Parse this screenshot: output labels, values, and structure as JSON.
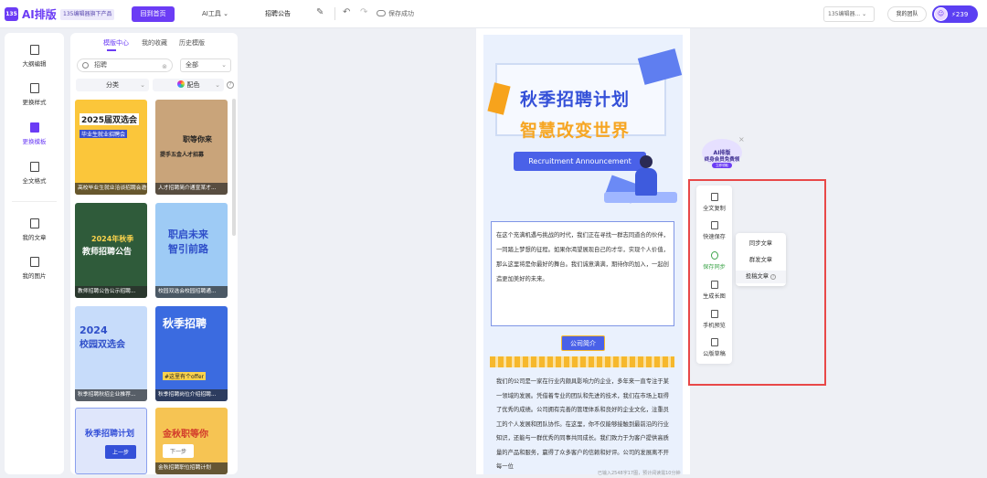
{
  "app": {
    "name": "AI排版",
    "logo_text": "135",
    "editor_chip": "135编辑器旗下产品"
  },
  "toolbar": {
    "back_label": "回到首页",
    "ai_tools_label": "AI工具",
    "doc_title": "招聘公告",
    "save_status": "保存成功",
    "editor_select": "135编辑器...",
    "team_label": "我的团队",
    "points": "239",
    "colors": {
      "accent": "#6b3cf5"
    }
  },
  "leftnav": {
    "items": [
      {
        "label": "大纲编辑",
        "icon": "pen-icon"
      },
      {
        "label": "更换样式",
        "icon": "style-icon"
      },
      {
        "label": "更换模板",
        "icon": "template-icon"
      },
      {
        "label": "全文格式",
        "icon": "format-icon"
      },
      {
        "label": "我的文章",
        "icon": "article-icon"
      },
      {
        "label": "我的图片",
        "icon": "image-icon"
      }
    ],
    "active_index": 2
  },
  "templates": {
    "tabs": [
      "模版中心",
      "我的收藏",
      "历史模版"
    ],
    "active_tab": 0,
    "search_value": "招聘",
    "filter_all": "全部",
    "filter_category": "分类",
    "filter_color": "配色",
    "items": [
      {
        "title": "2025届双选会",
        "subtitle": "毕业生就业招聘会",
        "caption": "高校毕业生就业洽谈招聘会邀请..."
      },
      {
        "title": "职等你来",
        "subtitle": "提手五金人才招募",
        "caption": "人才招聘简介通宣某才..."
      },
      {
        "title": "2024年秋季",
        "subtitle": "教师招聘公告",
        "caption": "教师招聘公告公示招聘..."
      },
      {
        "title": "职启未来",
        "subtitle": "智引前路",
        "caption": "校园双选会校园招聘通..."
      },
      {
        "title": "2024",
        "subtitle": "校园双选会",
        "caption": "秋季招聘秋招企业推荐..."
      },
      {
        "title": "秋季招聘",
        "subtitle": "#这里有个offer",
        "caption": "秋季招聘岗位介绍招聘..."
      },
      {
        "title": "秋季招聘计划",
        "subtitle": "上一步",
        "caption": ""
      },
      {
        "title": "金秋职等你",
        "subtitle": "下一步",
        "caption": "金秋招聘职位招聘计划"
      }
    ]
  },
  "poster": {
    "title1": "秋季招聘计划",
    "title2": "智慧改变世界",
    "badge": "Recruitment Announcement",
    "intro": "在这个充满机遇与挑战的时代，我们正在寻找一群志同道合的伙伴，一同踏上梦想的征程。如果你渴望展现自己的才华，实现个人价值，那么这里将是你最好的舞台。我们诚意满满，期待你的加入，一起创造更加美好的未来。",
    "section_title": "公司简介",
    "body": "我们的公司是一家在行业内颇具影响力的企业，多年来一直专注于某一领域的发展。凭借着专业的团队和先进的技术，我们在市场上取得了优秀的成绩。公司拥有完善的管理体系和良好的企业文化，注重员工的个人发展和团队协作。在这里，你不仅能够接触到最前沿的行业知识，还能与一群优秀的同事共同成长。我们致力于为客户提供高质量的产品和服务，赢得了众多客户的信赖和好评。公司的发展离不开每一位",
    "footer": "已输入2548字17图，预计阅读需10分钟"
  },
  "package_badge": {
    "line1": "AI排版",
    "line2": "终身会员免费领",
    "line3": "立即领取"
  },
  "actions": [
    {
      "label": "全文复制",
      "icon": "copy-icon"
    },
    {
      "label": "快速保存",
      "icon": "save-icon"
    },
    {
      "label": "保存同步",
      "icon": "sync-icon"
    },
    {
      "label": "生成长图",
      "icon": "long-image-icon"
    },
    {
      "label": "手机预览",
      "icon": "phone-icon"
    },
    {
      "label": "公版草稿",
      "icon": "draft-icon"
    }
  ],
  "sync_menu": [
    "同步文章",
    "群发文章",
    "投稿文章"
  ]
}
